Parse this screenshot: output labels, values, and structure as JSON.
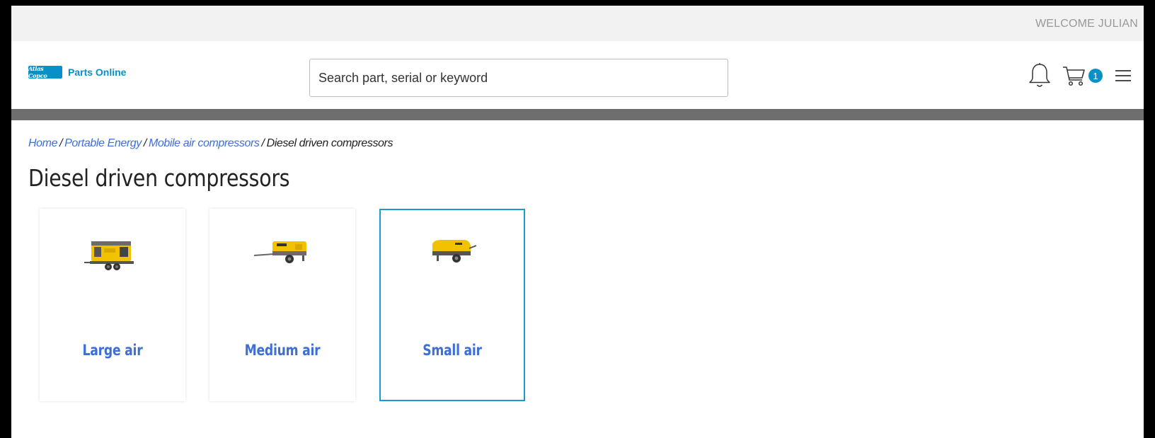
{
  "header": {
    "welcome": "WELCOME JULIAN",
    "logo_badge": "Atlas Copco",
    "logo_text": "Parts Online",
    "search_placeholder": "Search part, serial or keyword",
    "cart_count": "1",
    "icons": [
      "bell-icon",
      "cart-icon",
      "menu-icon"
    ]
  },
  "breadcrumb": [
    {
      "label": "Home",
      "link": true
    },
    {
      "label": "Portable Energy",
      "link": true
    },
    {
      "label": "Mobile air compressors",
      "link": true
    },
    {
      "label": "Diesel driven compressors",
      "link": false
    }
  ],
  "page": {
    "title": "Diesel driven compressors"
  },
  "categories": [
    {
      "label": "Large air",
      "image": "large-compressor-image",
      "selected": false
    },
    {
      "label": "Medium air",
      "image": "medium-compressor-image",
      "selected": false
    },
    {
      "label": "Small air",
      "image": "small-compressor-image",
      "selected": true
    }
  ],
  "colors": {
    "accent": "#0a8fc8",
    "link": "#3d6fd6",
    "selected_border": "#1a9ad6",
    "divider_bar": "#6e6e6e",
    "compressor_yellow": "#f2c200"
  }
}
